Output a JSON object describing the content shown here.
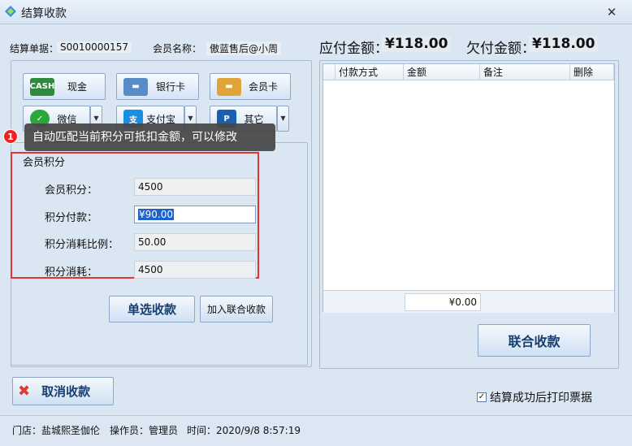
{
  "window": {
    "title": "结算收款",
    "close_glyph": "✕"
  },
  "header": {
    "bill_label": "结算单据：",
    "bill_no": "S0010000157",
    "member_label": "会员名称：",
    "member_name": "傲蓝售后@小周",
    "payable_label": "应付金额：",
    "payable_value": "¥118.00",
    "owed_label": "欠付金额：",
    "owed_value": "¥118.00"
  },
  "pay_buttons": [
    {
      "label": "现金",
      "icon": "cash-icon"
    },
    {
      "label": "银行卡",
      "icon": "bank-card-icon"
    },
    {
      "label": "会员卡",
      "icon": "member-card-icon"
    },
    {
      "label": "微信",
      "icon": "wechat-icon"
    },
    {
      "label": "支付宝",
      "icon": "alipay-icon"
    },
    {
      "label": "其它",
      "icon": "paypal-icon"
    }
  ],
  "tooltip": {
    "number": "1",
    "text": "自动匹配当前积分可抵扣金额，可以修改"
  },
  "points": {
    "group_title": "会员积分",
    "fields": [
      {
        "label": "会员积分：",
        "value": "4500"
      },
      {
        "label": "积分付款：",
        "value": "¥90.00"
      },
      {
        "label": "积分消耗比例：",
        "value": "50.00"
      },
      {
        "label": "积分消耗：",
        "value": "4500"
      }
    ]
  },
  "actions": {
    "single_pay": "单选收款",
    "add_combined": "加入联合收款",
    "combined_pay": "联合收款",
    "cancel": "取消收款"
  },
  "grid": {
    "columns": [
      "付款方式",
      "金额",
      "备注",
      "删除"
    ],
    "total": "¥0.00"
  },
  "print_option": {
    "label": "结算成功后打印票据",
    "checked": true
  },
  "status": {
    "store": "门店：盐城熙圣伽伦",
    "operator": "操作员：管理员",
    "time": "时间：2020/9/8 8:57:19"
  },
  "colors": {
    "highlight_border": "#e53333",
    "title_text": "#173f6e"
  }
}
